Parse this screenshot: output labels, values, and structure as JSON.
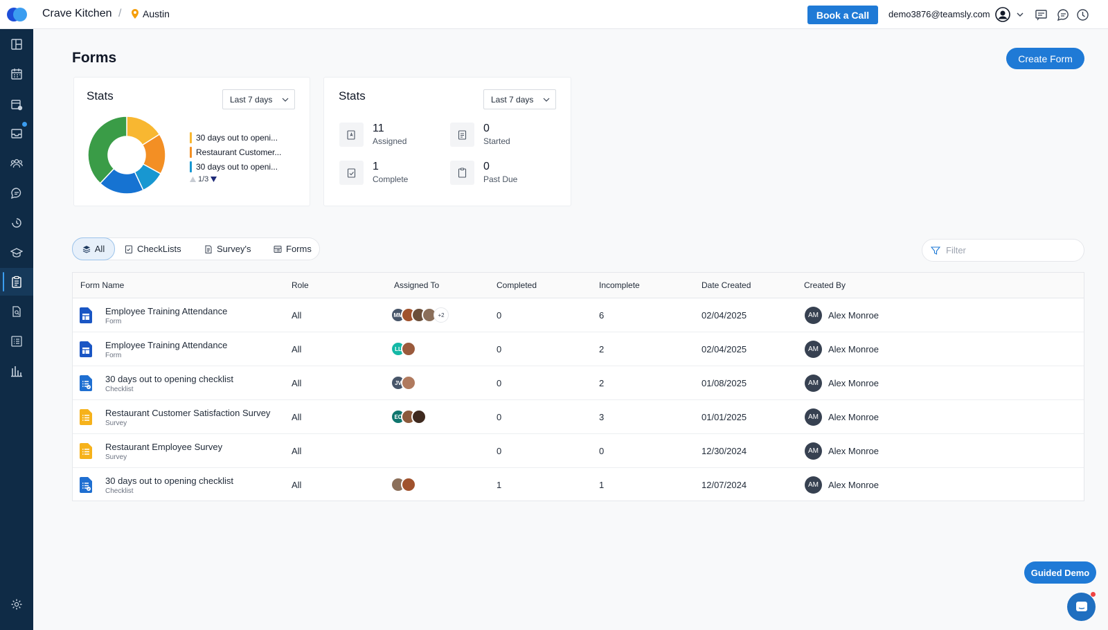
{
  "header": {
    "app_name": "Crave Kitchen",
    "separator": "/",
    "location": "Austin",
    "book_call_label": "Book a Call",
    "user_email": "demo3876@teamsly.com"
  },
  "page": {
    "title": "Forms",
    "create_button": "Create Form"
  },
  "stats_chart": {
    "title": "Stats",
    "period": "Last 7 days",
    "legend": [
      {
        "label": "30 days out to openi...",
        "color": "#f8b731"
      },
      {
        "label": "Restaurant Customer...",
        "color": "#f38f24"
      },
      {
        "label": "30 days out to openi...",
        "color": "#1897d1"
      }
    ],
    "pager": "1/3"
  },
  "chart_data": {
    "type": "pie",
    "title": "Stats",
    "slices": [
      {
        "value": 16,
        "color": "#f8b731"
      },
      {
        "value": 17,
        "color": "#f38f24"
      },
      {
        "value": 10,
        "color": "#1897d1"
      },
      {
        "value": 19,
        "color": "#1673d2"
      },
      {
        "value": 38,
        "color": "#3a9c47"
      }
    ]
  },
  "stats_counts": {
    "title": "Stats",
    "period": "Last 7 days",
    "items": [
      {
        "value": "11",
        "label": "Assigned"
      },
      {
        "value": "0",
        "label": "Started"
      },
      {
        "value": "1",
        "label": "Complete"
      },
      {
        "value": "0",
        "label": "Past Due"
      }
    ]
  },
  "tabs": [
    "All",
    "CheckLists",
    "Survey's",
    "Forms"
  ],
  "filter": {
    "placeholder": "Filter"
  },
  "table": {
    "columns": [
      "Form Name",
      "Role",
      "Assigned To",
      "Completed",
      "Incomplete",
      "Date Created",
      "Created By"
    ],
    "rows": [
      {
        "name": "Employee Training Attendance",
        "type": "Form",
        "role": "All",
        "completed": "0",
        "incomplete": "6",
        "date": "02/04/2025",
        "creator_initials": "AM",
        "creator": "Alex Monroe",
        "icon": "form-icon",
        "avatars": [
          "MM",
          "",
          "",
          ""
        ],
        "more": "+2"
      },
      {
        "name": "Employee Training Attendance",
        "type": "Form",
        "role": "All",
        "completed": "0",
        "incomplete": "2",
        "date": "02/04/2025",
        "creator_initials": "AM",
        "creator": "Alex Monroe",
        "icon": "form-icon",
        "avatars": [
          "LL",
          ""
        ],
        "more": ""
      },
      {
        "name": "30 days out to opening checklist",
        "type": "Checklist",
        "role": "All",
        "completed": "0",
        "incomplete": "2",
        "date": "01/08/2025",
        "creator_initials": "AM",
        "creator": "Alex Monroe",
        "icon": "checklist-icon",
        "avatars": [
          "JV",
          ""
        ],
        "more": ""
      },
      {
        "name": "Restaurant Customer Satisfaction Survey",
        "type": "Survey",
        "role": "All",
        "completed": "0",
        "incomplete": "3",
        "date": "01/01/2025",
        "creator_initials": "AM",
        "creator": "Alex Monroe",
        "icon": "survey-icon",
        "avatars": [
          "EC",
          "",
          ""
        ],
        "more": ""
      },
      {
        "name": "Restaurant Employee Survey",
        "type": "Survey",
        "role": "All",
        "completed": "0",
        "incomplete": "0",
        "date": "12/30/2024",
        "creator_initials": "AM",
        "creator": "Alex Monroe",
        "icon": "survey-icon",
        "avatars": [],
        "more": ""
      },
      {
        "name": "30 days out to opening checklist",
        "type": "Checklist",
        "role": "All",
        "completed": "1",
        "incomplete": "1",
        "date": "12/07/2024",
        "creator_initials": "AM",
        "creator": "Alex Monroe",
        "icon": "checklist-icon",
        "avatars": [
          "",
          ""
        ],
        "more": ""
      }
    ]
  },
  "guided_demo": "Guided Demo",
  "colors": {
    "accent": "#1f7ad6",
    "sidebar": "#0f2b46"
  }
}
